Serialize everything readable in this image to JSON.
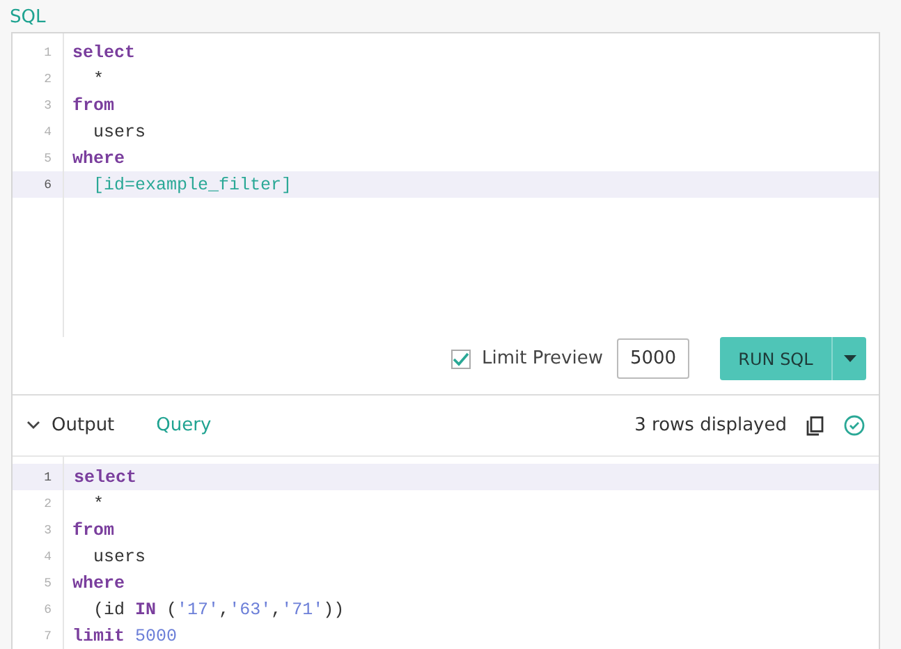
{
  "title": "SQL",
  "editor": {
    "lines": [
      {
        "number": "1",
        "active": false,
        "tokens": [
          {
            "kind": "keyword",
            "text": "select"
          }
        ]
      },
      {
        "number": "2",
        "active": false,
        "tokens": [
          {
            "kind": "plain",
            "text": "  *"
          }
        ]
      },
      {
        "number": "3",
        "active": false,
        "tokens": [
          {
            "kind": "keyword",
            "text": "from"
          }
        ]
      },
      {
        "number": "4",
        "active": false,
        "tokens": [
          {
            "kind": "plain",
            "text": "  users"
          }
        ]
      },
      {
        "number": "5",
        "active": false,
        "tokens": [
          {
            "kind": "keyword",
            "text": "where"
          }
        ]
      },
      {
        "number": "6",
        "active": true,
        "tokens": [
          {
            "kind": "template",
            "text": "  [id=example_filter]"
          }
        ]
      }
    ]
  },
  "limit_preview": {
    "label": "Limit Preview",
    "checked": true,
    "value": "5000"
  },
  "run_button": {
    "label": "RUN SQL"
  },
  "output": {
    "title": "Output",
    "expanded": true,
    "tabs": [
      {
        "label": "Query",
        "selected": true
      }
    ],
    "status": "3 rows displayed",
    "success": true
  },
  "query": {
    "lines": [
      {
        "number": "1",
        "active": true,
        "tokens": [
          {
            "kind": "keyword",
            "text": "select"
          }
        ]
      },
      {
        "number": "2",
        "active": false,
        "tokens": [
          {
            "kind": "plain",
            "text": "  *"
          }
        ]
      },
      {
        "number": "3",
        "active": false,
        "tokens": [
          {
            "kind": "keyword",
            "text": "from"
          }
        ]
      },
      {
        "number": "4",
        "active": false,
        "tokens": [
          {
            "kind": "plain",
            "text": "  users"
          }
        ]
      },
      {
        "number": "5",
        "active": false,
        "tokens": [
          {
            "kind": "keyword",
            "text": "where"
          }
        ]
      },
      {
        "number": "6",
        "active": false,
        "tokens": [
          {
            "kind": "plain",
            "text": "  (id "
          },
          {
            "kind": "keyword",
            "text": "IN"
          },
          {
            "kind": "plain",
            "text": " ("
          },
          {
            "kind": "string",
            "text": "'17'"
          },
          {
            "kind": "plain",
            "text": ","
          },
          {
            "kind": "string",
            "text": "'63'"
          },
          {
            "kind": "plain",
            "text": ","
          },
          {
            "kind": "string",
            "text": "'71'"
          },
          {
            "kind": "plain",
            "text": "))"
          }
        ]
      },
      {
        "number": "7",
        "active": false,
        "tokens": [
          {
            "kind": "keyword",
            "text": "limit"
          },
          {
            "kind": "number",
            "text": " 5000"
          }
        ]
      }
    ]
  }
}
